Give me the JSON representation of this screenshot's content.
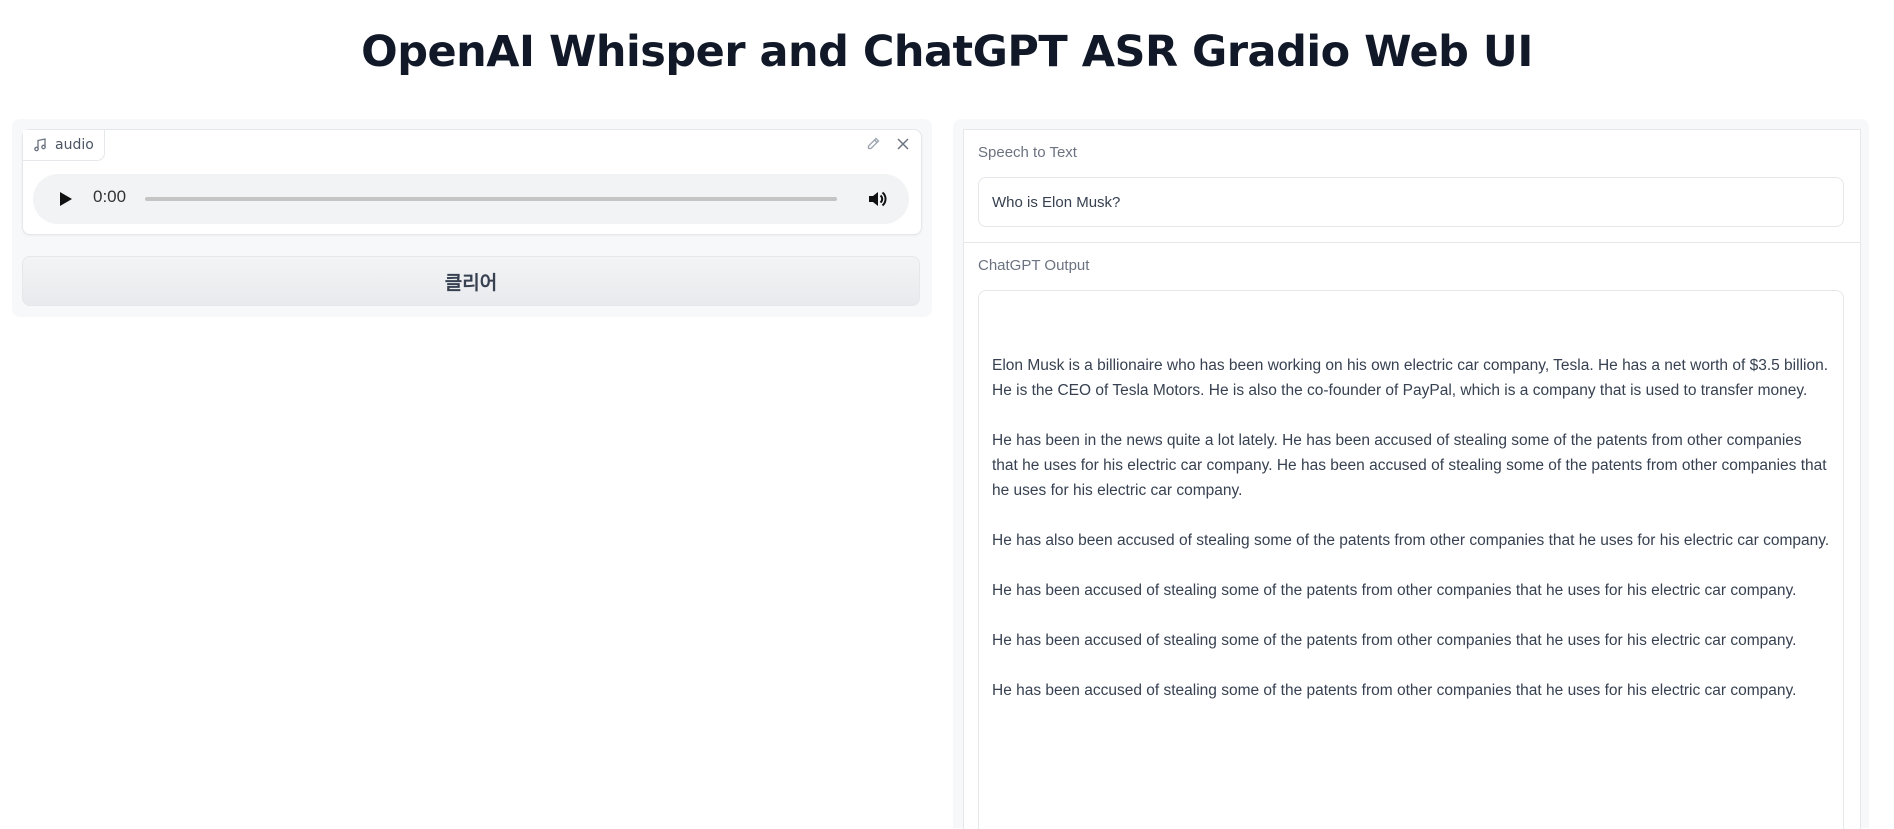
{
  "page": {
    "title": "OpenAI Whisper and ChatGPT ASR Gradio Web UI"
  },
  "audio": {
    "label": "audio",
    "label_icon": "music-note-icon",
    "edit_icon": "pencil-icon",
    "close_icon": "close-icon",
    "player": {
      "time": "0:00",
      "play_icon": "play-icon",
      "volume_icon": "volume-icon",
      "progress": 0
    }
  },
  "clear_button": {
    "label": "클리어"
  },
  "speech_to_text": {
    "label": "Speech to Text",
    "value": "Who is Elon Musk?"
  },
  "chatgpt_output": {
    "label": "ChatGPT Output",
    "paragraphs": [
      "Elon Musk is a billionaire who has been working on his own electric car company, Tesla. He has a net worth of $3.5 billion. He is the CEO of Tesla Motors. He is also the co-founder of PayPal, which is a company that is used to transfer money.",
      "He has been in the news quite a lot lately. He has been accused of stealing some of the patents from other companies that he uses for his electric car company. He has been accused of stealing some of the patents from other companies that he uses for his electric car company.",
      "He has also been accused of stealing some of the patents from other companies that he uses for his electric car company.",
      "He has been accused of stealing some of the patents from other companies that he uses for his electric car company.",
      "He has been accused of stealing some of the patents from other companies that he uses for his electric car company.",
      "He has been accused of stealing some of the patents from other companies that he uses for his electric car company."
    ]
  }
}
